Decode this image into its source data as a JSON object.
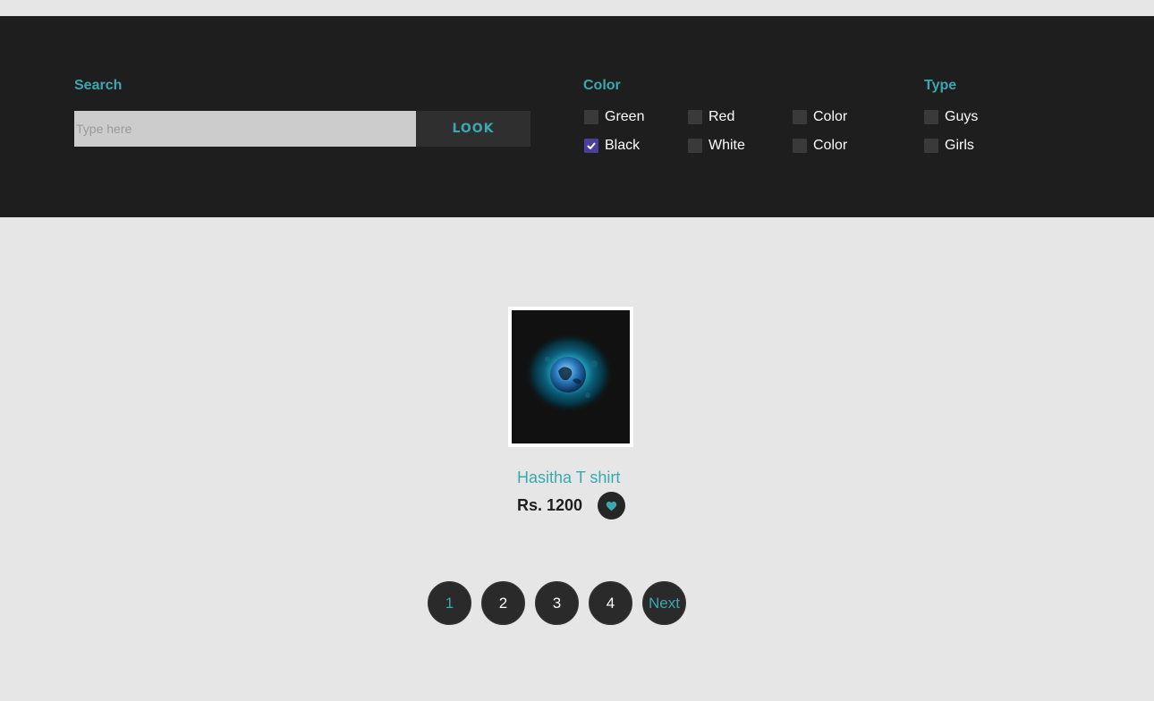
{
  "filters": {
    "search": {
      "title": "Search",
      "placeholder": "Type here",
      "value": "",
      "button_label": "LOOK"
    },
    "color": {
      "title": "Color",
      "options": [
        {
          "label": "Green",
          "checked": false
        },
        {
          "label": "Red",
          "checked": false
        },
        {
          "label": "Color",
          "checked": false
        },
        {
          "label": "Black",
          "checked": true
        },
        {
          "label": "White",
          "checked": false
        },
        {
          "label": "Color",
          "checked": false
        }
      ]
    },
    "type": {
      "title": "Type",
      "options": [
        {
          "label": "Guys",
          "checked": false
        },
        {
          "label": "Girls",
          "checked": false
        }
      ]
    }
  },
  "products": [
    {
      "name": "Hasitha T shirt",
      "price": "Rs. 1200",
      "favorite_icon": "heart-icon"
    }
  ],
  "pagination": {
    "pages": [
      "1",
      "2",
      "3",
      "4"
    ],
    "current": "1",
    "next_label": "Next"
  },
  "colors": {
    "accent": "#3aa8ae",
    "dark_bar": "#1e1e1e",
    "page_background": "#e6e6e6",
    "checkbox_checked": "#4a3f9a"
  }
}
